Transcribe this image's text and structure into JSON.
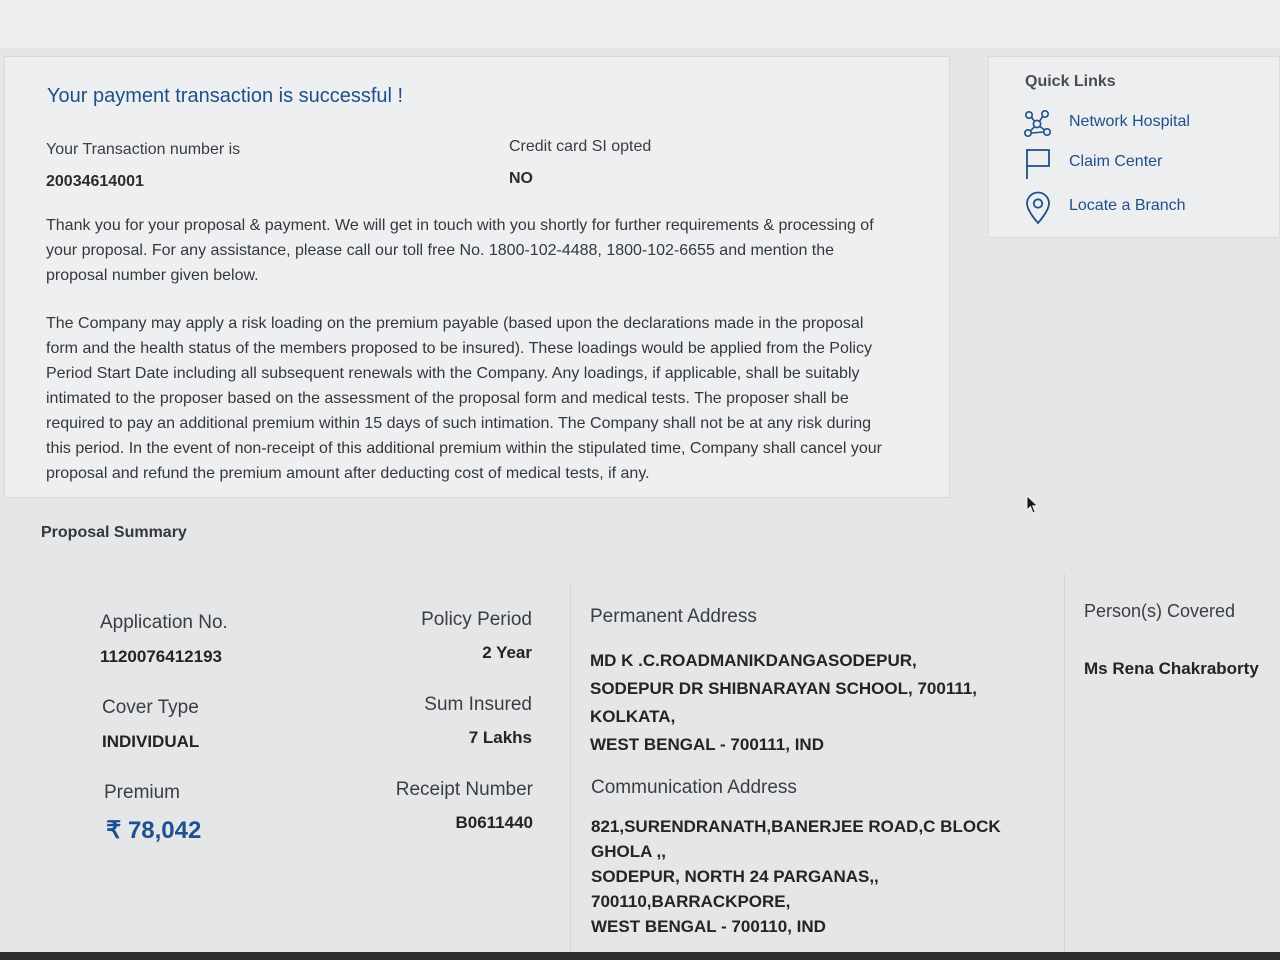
{
  "main": {
    "success_title": "Your payment transaction is successful !",
    "txn_label": "Your Transaction number is",
    "txn_value": "20034614001",
    "si_label": "Credit card SI opted",
    "si_value": "NO",
    "para1_lines": [
      "Thank you for your proposal & payment. We will get in touch with you shortly for further requirements & processing of",
      "your proposal. For any assistance, please call our toll free No. 1800-102-4488, 1800-102-6655 and mention the",
      "proposal number given below."
    ],
    "para2_lines": [
      "The Company may apply a risk loading on the premium payable (based upon the declarations made in the proposal",
      "form and the health status of the members proposed to be insured). These loadings would be applied from the Policy",
      "Period Start Date including all subsequent renewals with the Company. Any loadings, if applicable, shall be suitably",
      "intimated to the proposer based on the assessment of the proposal form and medical tests. The proposer shall be",
      "required to pay an additional premium within 15 days of such intimation. The Company shall not be at any risk during",
      "this period. In the event of non-receipt of this additional premium within the stipulated time, Company shall cancel your",
      "proposal and refund the premium amount after deducting cost of medical tests, if any."
    ]
  },
  "quick_links": {
    "title": "Quick Links",
    "items": [
      {
        "label": "Network Hospital",
        "icon": "network-icon"
      },
      {
        "label": "Claim Center",
        "icon": "flag-icon"
      },
      {
        "label": "Locate a Branch",
        "icon": "location-pin-icon"
      }
    ]
  },
  "summary": {
    "title": "Proposal Summary",
    "application_no_label": "Application No.",
    "application_no": "1120076412193",
    "policy_period_label": "Policy Period",
    "policy_period": "2 Year",
    "cover_type_label": "Cover Type",
    "cover_type": "INDIVIDUAL",
    "sum_insured_label": "Sum Insured",
    "sum_insured": "7 Lakhs",
    "premium_label": "Premium",
    "premium": "₹ 78,042",
    "receipt_label": "Receipt Number",
    "receipt": "B0611440",
    "permanent_address_label": "Permanent Address",
    "permanent_address_lines": [
      "MD K .C.ROADMANIKDANGASODEPUR,",
      "SODEPUR DR SHIBNARAYAN SCHOOL, 700111,",
      "KOLKATA,",
      "WEST BENGAL - 700111, IND"
    ],
    "communication_address_label": "Communication Address",
    "communication_address_lines": [
      "821,SURENDRANATH,BANERJEE ROAD,C BLOCK",
      "GHOLA ,,",
      "SODEPUR, NORTH 24 PARGANAS,,",
      "700110,BARRACKPORE,",
      "WEST BENGAL - 700110, IND"
    ],
    "persons_covered_label": "Person(s) Covered",
    "persons_covered": "Ms Rena Chakraborty"
  },
  "colors": {
    "link_blue": "#1f4f8a",
    "premium_blue": "#1e4f8e",
    "background": "#e4e6e8"
  }
}
